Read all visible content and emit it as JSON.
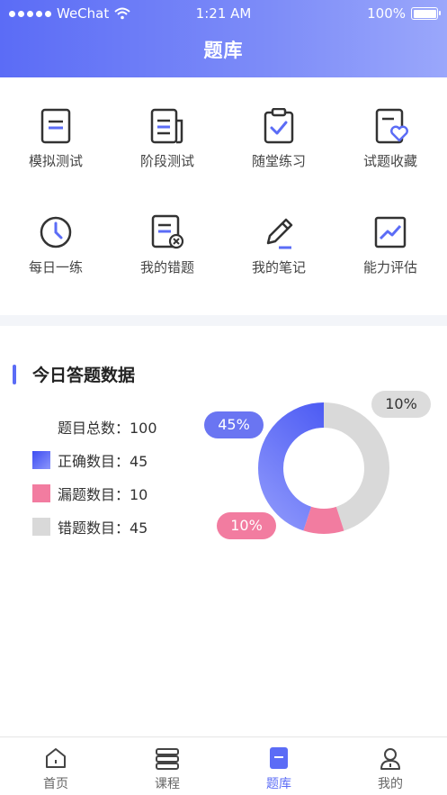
{
  "status_bar": {
    "carrier": "WeChat",
    "time": "1:21 AM",
    "battery": "100%"
  },
  "header": {
    "title": "题库"
  },
  "grid": {
    "items": [
      {
        "label": "模拟测试",
        "icon": "document-icon"
      },
      {
        "label": "阶段测试",
        "icon": "stacked-documents-icon"
      },
      {
        "label": "随堂练习",
        "icon": "clipboard-check-icon"
      },
      {
        "label": "试题收藏",
        "icon": "document-heart-icon"
      },
      {
        "label": "每日一练",
        "icon": "clock-icon"
      },
      {
        "label": "我的错题",
        "icon": "document-x-icon"
      },
      {
        "label": "我的笔记",
        "icon": "pencil-icon"
      },
      {
        "label": "能力评估",
        "icon": "trend-chart-icon"
      }
    ]
  },
  "section": {
    "title": "今日答题数据"
  },
  "stats": {
    "total": "题目总数：100",
    "correct": "正确数目：45",
    "missed": "漏题数目：10",
    "wrong": "错题数目：45"
  },
  "chart_data": {
    "type": "pie",
    "donut": true,
    "categories": [
      "正确数目",
      "漏题数目",
      "错题数目"
    ],
    "values": [
      45,
      10,
      45
    ],
    "labels": [
      "45%",
      "10%",
      "10%"
    ],
    "colors": [
      "#5b6cf6",
      "#f27ca0",
      "#d9d9d9"
    ]
  },
  "tabbar": {
    "tabs": [
      {
        "label": "首页",
        "icon": "home-icon"
      },
      {
        "label": "课程",
        "icon": "books-icon"
      },
      {
        "label": "题库",
        "icon": "question-bank-icon"
      },
      {
        "label": "我的",
        "icon": "user-icon"
      }
    ],
    "active_color": "#5b6cf6"
  }
}
